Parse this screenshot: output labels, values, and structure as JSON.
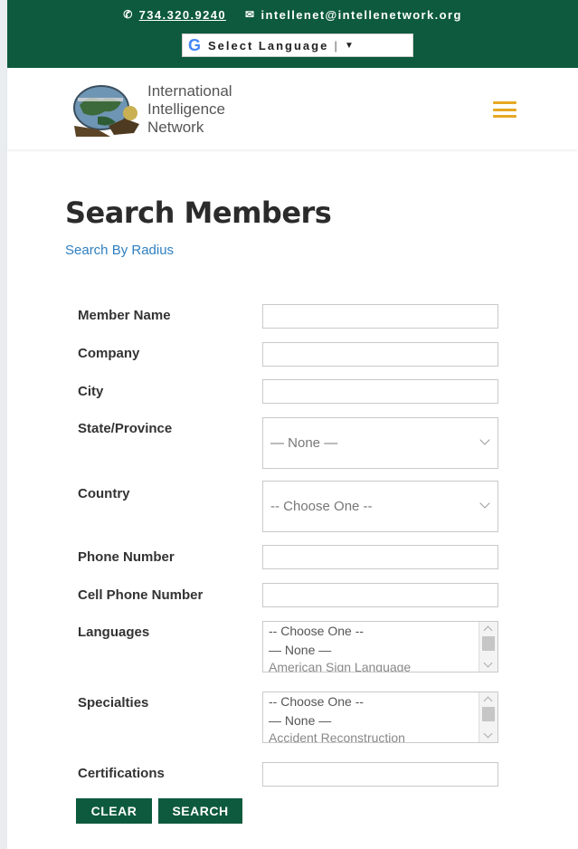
{
  "topbar": {
    "phone": "734.320.9240",
    "email": "intellenet@intellenetwork.org",
    "translate_label": "Select Language",
    "translate_icon": "google-g-icon"
  },
  "header": {
    "brand_line1": "International",
    "brand_line2": "Intelligence",
    "brand_line3": "Network",
    "menu_icon": "hamburger-menu-icon",
    "accent_color": "#e6a823",
    "brand_green": "#0d5a3e"
  },
  "page": {
    "title": "Search Members",
    "radius_link": "Search By Radius"
  },
  "form": {
    "member_name_label": "Member Name",
    "company_label": "Company",
    "city_label": "City",
    "state_label": "State/Province",
    "state_value": "— None —",
    "country_label": "Country",
    "country_value": "-- Choose One --",
    "phone_label": "Phone Number",
    "cell_label": "Cell Phone Number",
    "languages_label": "Languages",
    "languages_options": [
      "-- Choose One --",
      "— None —",
      "American Sign Language"
    ],
    "specialties_label": "Specialties",
    "specialties_options": [
      "-- Choose One --",
      "— None —",
      "Accident Reconstruction"
    ],
    "certifications_label": "Certifications",
    "clear_label": "CLEAR",
    "search_label": "SEARCH"
  }
}
